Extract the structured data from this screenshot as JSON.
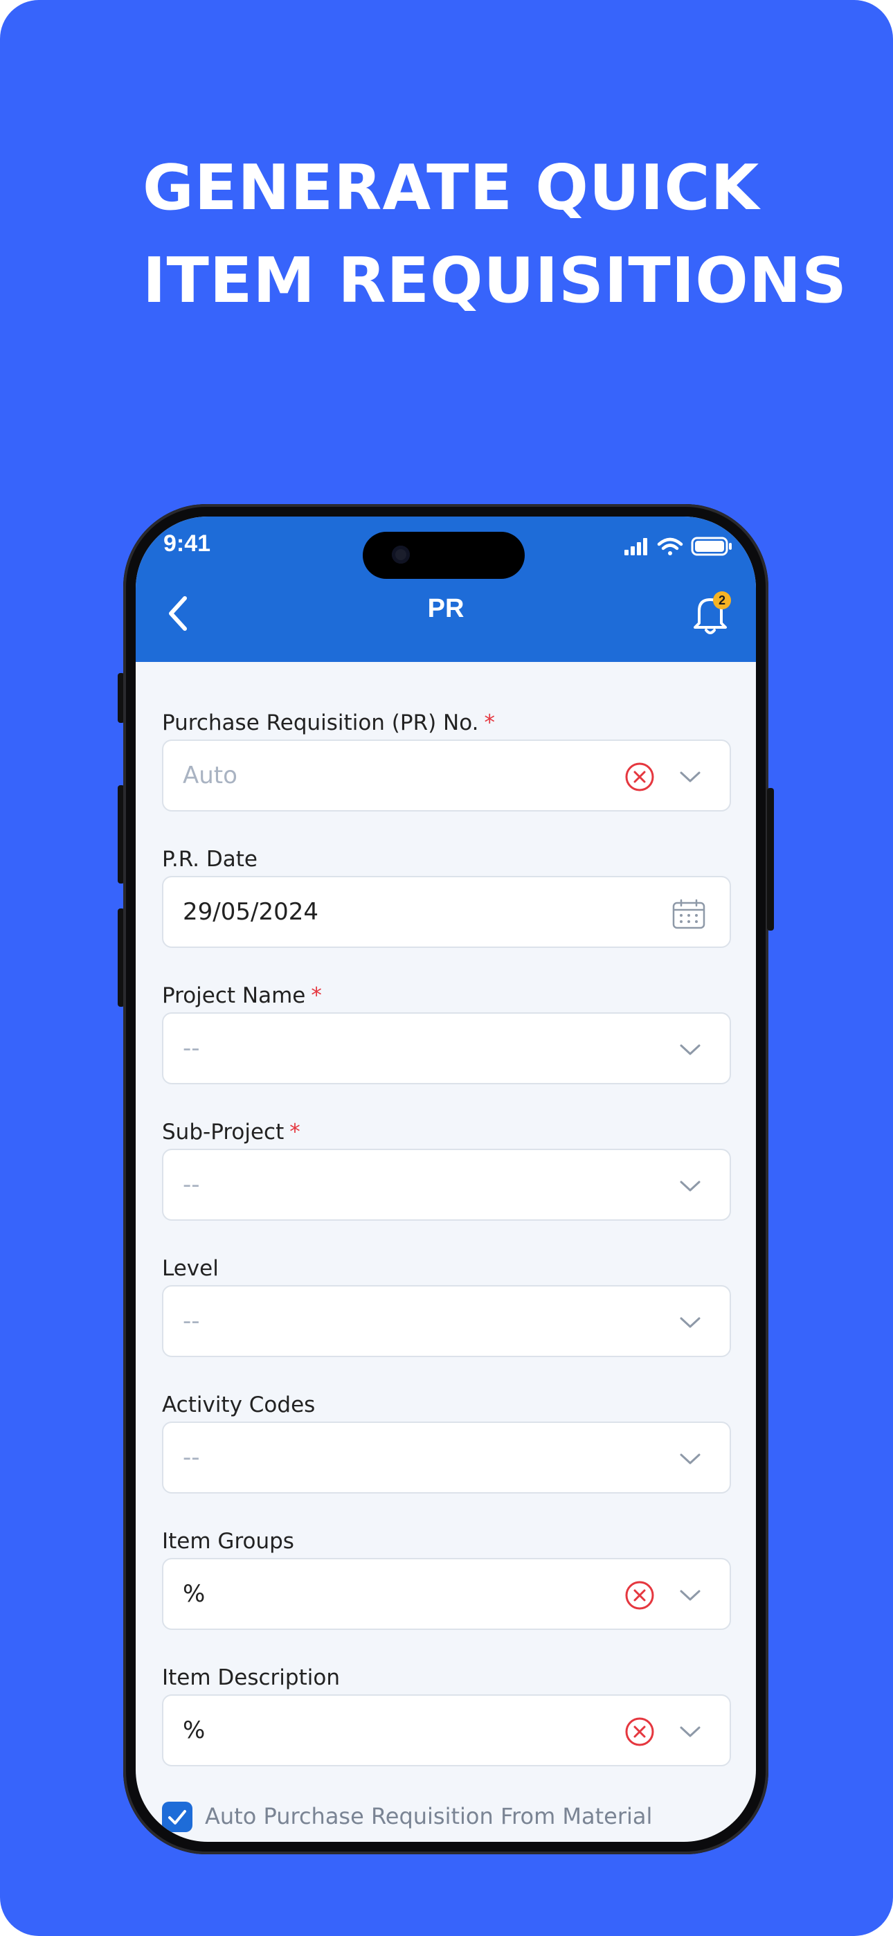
{
  "headline": {
    "line1": "GENERATE QUICK",
    "line2": "ITEM REQUISITIONS"
  },
  "status_bar": {
    "time": "9:41"
  },
  "header": {
    "title": "PR",
    "notification_count": "2"
  },
  "fields": [
    {
      "label": "Purchase Requisition (PR) No.",
      "required": "*",
      "value": "Auto",
      "placeholder": true
    },
    {
      "label": "P.R. Date",
      "required": "",
      "value": "29/05/2024",
      "placeholder": false
    },
    {
      "label": "Project Name",
      "required": "*",
      "value": "--",
      "placeholder": true
    },
    {
      "label": "Sub-Project",
      "required": "*",
      "value": "--",
      "placeholder": true
    },
    {
      "label": "Level",
      "required": "",
      "value": "--",
      "placeholder": true
    },
    {
      "label": "Activity Codes",
      "required": "",
      "value": "--",
      "placeholder": true
    },
    {
      "label": "Item Groups",
      "required": "",
      "value": "%",
      "placeholder": false
    },
    {
      "label": "Item Description",
      "required": "",
      "value": "%",
      "placeholder": false
    }
  ],
  "checkbox": {
    "label": "Auto Purchase Requisition From Material",
    "checked": true
  },
  "colors": {
    "background": "#3764FB",
    "header": "#1E6CD8",
    "clear": "#E5373F",
    "badge": "#F5B324"
  }
}
